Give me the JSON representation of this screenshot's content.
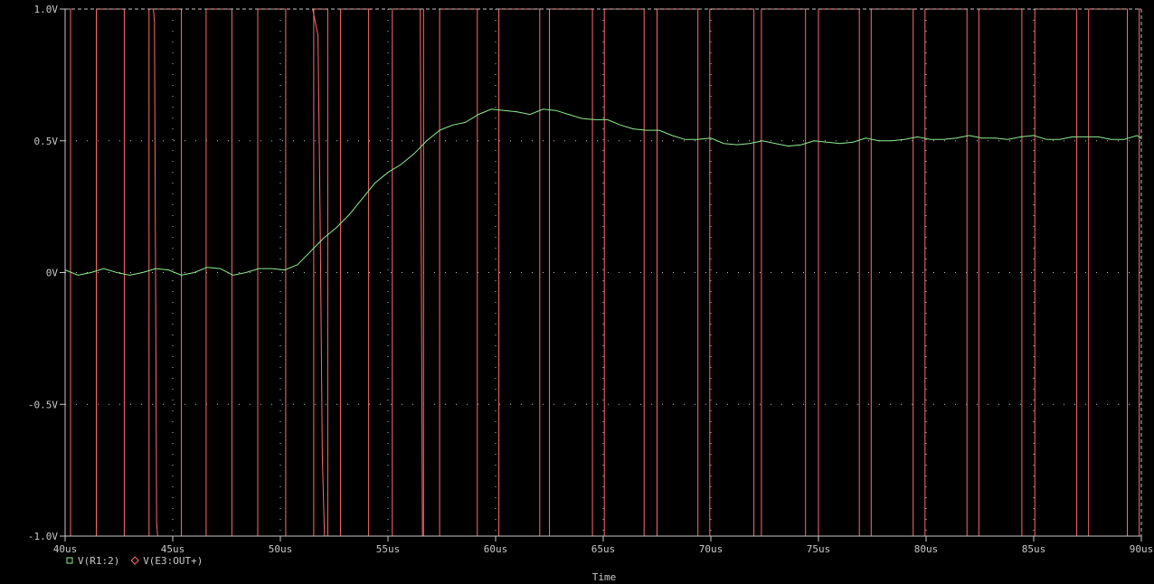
{
  "chart_data": {
    "type": "line",
    "xlabel": "Time",
    "ylabel": "",
    "xlim": [
      40,
      90
    ],
    "ylim": [
      -1,
      1
    ],
    "x_unit": "us",
    "grid": true,
    "legend": "bottom-left",
    "x_ticks": [
      {
        "value": 40,
        "label": "40us"
      },
      {
        "value": 45,
        "label": "45us"
      },
      {
        "value": 50,
        "label": "50us"
      },
      {
        "value": 55,
        "label": "55us"
      },
      {
        "value": 60,
        "label": "60us"
      },
      {
        "value": 65,
        "label": "65us"
      },
      {
        "value": 70,
        "label": "70us"
      },
      {
        "value": 75,
        "label": "75us"
      },
      {
        "value": 80,
        "label": "80us"
      },
      {
        "value": 85,
        "label": "85us"
      },
      {
        "value": 90,
        "label": "90us"
      }
    ],
    "y_ticks": [
      {
        "value": 1.0,
        "label": "1.0V"
      },
      {
        "value": 0.5,
        "label": "0.5V"
      },
      {
        "value": 0,
        "label": "0V"
      },
      {
        "value": -0.5,
        "label": "-0.5V"
      },
      {
        "value": -1.0,
        "label": "-1.0V"
      }
    ],
    "series": [
      {
        "name": "V(R1:2)",
        "marker": "square",
        "color": "#90ee90",
        "x": [
          40.0,
          40.6,
          41.2,
          41.8,
          42.4,
          43.0,
          43.6,
          44.2,
          44.8,
          45.4,
          46.0,
          46.6,
          47.2,
          47.8,
          48.4,
          49.0,
          49.6,
          50.2,
          50.8,
          51.4,
          52.0,
          52.6,
          53.2,
          53.8,
          54.4,
          55.0,
          55.6,
          56.2,
          56.8,
          57.4,
          58.0,
          58.6,
          59.2,
          59.8,
          60.4,
          61.0,
          61.6,
          62.2,
          62.8,
          63.4,
          64.0,
          64.6,
          65.2,
          65.8,
          66.4,
          67.0,
          67.6,
          68.2,
          68.8,
          69.4,
          70.0,
          70.6,
          71.2,
          71.8,
          72.4,
          73.0,
          73.6,
          74.2,
          74.8,
          75.4,
          76.0,
          76.6,
          77.2,
          77.8,
          78.4,
          79.0,
          79.6,
          80.2,
          80.8,
          81.4,
          82.0,
          82.6,
          83.2,
          83.8,
          84.4,
          85.0,
          85.6,
          86.2,
          86.8,
          87.4,
          88.0,
          88.6,
          89.2,
          89.8,
          90.0
        ],
        "y": [
          0.01,
          -0.01,
          0.0,
          0.015,
          0.0,
          -0.01,
          0.0,
          0.015,
          0.01,
          -0.01,
          0.0,
          0.02,
          0.015,
          -0.01,
          0.0,
          0.015,
          0.015,
          0.01,
          0.03,
          0.08,
          0.13,
          0.17,
          0.22,
          0.28,
          0.34,
          0.38,
          0.41,
          0.45,
          0.5,
          0.54,
          0.56,
          0.57,
          0.6,
          0.62,
          0.615,
          0.61,
          0.6,
          0.62,
          0.615,
          0.6,
          0.585,
          0.58,
          0.58,
          0.56,
          0.545,
          0.54,
          0.54,
          0.52,
          0.505,
          0.505,
          0.51,
          0.49,
          0.485,
          0.49,
          0.5,
          0.49,
          0.48,
          0.485,
          0.5,
          0.495,
          0.49,
          0.495,
          0.51,
          0.5,
          0.5,
          0.505,
          0.515,
          0.505,
          0.505,
          0.51,
          0.52,
          0.51,
          0.51,
          0.505,
          0.515,
          0.52,
          0.505,
          0.505,
          0.515,
          0.515,
          0.515,
          0.505,
          0.505,
          0.52,
          0.51
        ]
      },
      {
        "name": "V(E3:OUT+)",
        "marker": "diamond",
        "color": "#ff6b6b",
        "levels": [
          -1,
          1
        ],
        "initial_level": 1,
        "transitions": [
          40.25,
          41.45,
          42.75,
          43.9,
          45.4,
          46.55,
          47.75,
          48.95,
          50.25,
          51.55,
          52.2,
          52.8,
          54.1,
          55.2,
          56.65,
          57.4,
          59.15,
          60.15,
          62.05,
          62.5,
          64.5,
          65.05,
          66.9,
          67.5,
          69.4,
          69.95,
          72.0,
          72.35,
          74.4,
          75.0,
          76.9,
          77.45,
          79.4,
          79.95,
          81.9,
          82.45,
          84.45,
          85.05,
          87.0,
          87.55,
          89.35,
          89.9
        ],
        "glitches": [
          {
            "x": [
              44.1,
              44.15,
              44.2,
              44.25,
              44.3
            ],
            "y": [
              1.0,
              0.95,
              0.0,
              -0.95,
              -1.0
            ]
          },
          {
            "x": [
              51.5,
              51.75,
              51.85,
              51.95,
              52.05
            ],
            "y": [
              1.0,
              0.9,
              0.2,
              -0.7,
              -1.0
            ]
          },
          {
            "x": [
              56.5,
              56.55,
              56.6
            ],
            "y": [
              1.0,
              0.0,
              -1.0
            ]
          }
        ]
      }
    ]
  }
}
